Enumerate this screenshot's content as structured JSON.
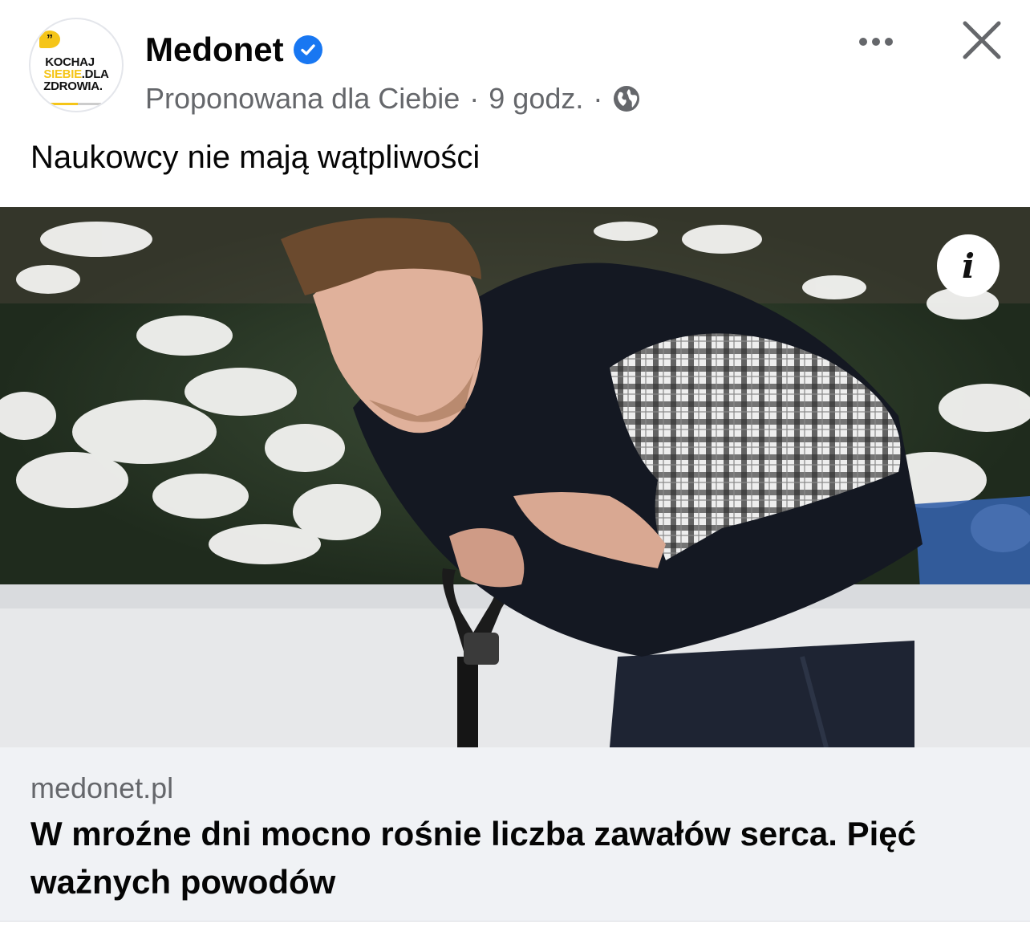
{
  "header": {
    "page_name": "Medonet",
    "subtitle": "Proponowana dla Ciebie",
    "time": "9 godz.",
    "separator": "·",
    "avatar_logo": {
      "quote": "”",
      "line1": "KOCHAJ",
      "line2_yellow": "SIEBIE",
      "line2_rest": ".DLA",
      "line3": "ZDROWIA."
    },
    "icons": {
      "verified": "verified-badge-icon",
      "audience": "globe-icon",
      "more": "more-horizontal-icon",
      "close": "close-icon"
    }
  },
  "post": {
    "text": "Naukowcy nie mają wątpliwości",
    "info_label": "i"
  },
  "link_preview": {
    "domain": "medonet.pl",
    "title": "W mroźne dni mocno rośnie liczba zawałów serca. Pięć ważnych powodów"
  },
  "colors": {
    "accent": "#1877f2",
    "secondary_text": "#65676b",
    "link_bg": "#f0f2f5",
    "logo_yellow": "#f5c518"
  }
}
